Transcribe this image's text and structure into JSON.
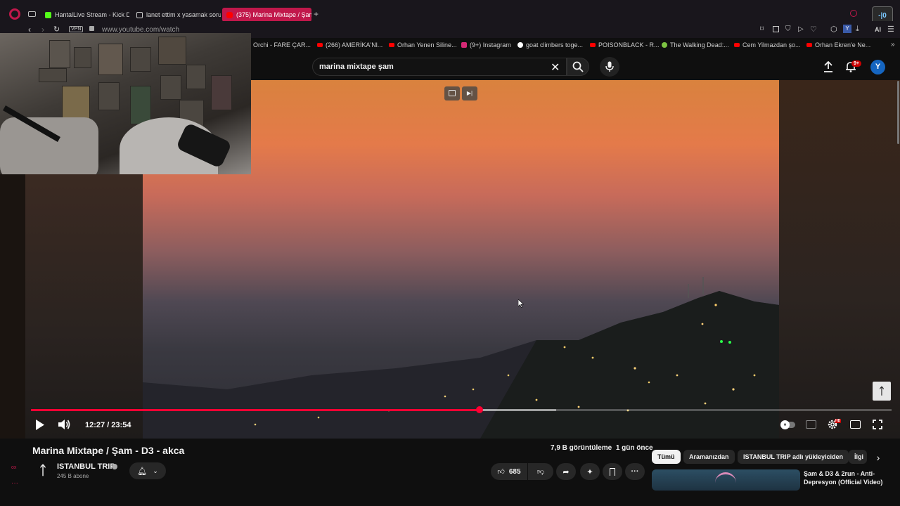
{
  "browser": {
    "tabs": [
      {
        "label": "HantalLive Stream - Kick D...",
        "color": "#53fc18"
      },
      {
        "label": "lanet ettim x yasamak soru...",
        "color": "#cccccc"
      },
      {
        "label": "(375) Marina Mixtape / Şam",
        "color": "#ff0000"
      }
    ],
    "vpn": "VPN",
    "url": "www.youtube.com/watch",
    "ai_label": "AI"
  },
  "bookmarks": [
    {
      "label": "Orchi - FARE ÇAR...",
      "color": "#ff0000"
    },
    {
      "label": "(266) AMERİKA'Nl...",
      "color": "#ff0000"
    },
    {
      "label": "Orhan Yenen Siline...",
      "color": "#ff0000"
    },
    {
      "label": "(9+) Instagram",
      "color": "#d62976"
    },
    {
      "label": "goat climbers toge...",
      "color": "#ffffff"
    },
    {
      "label": "POISONBLACK - R...",
      "color": "#ff0000"
    },
    {
      "label": "The Walking Dead:...",
      "color": "#7cc242"
    },
    {
      "label": "Cem Yilmazdan şo...",
      "color": "#ff0000"
    },
    {
      "label": "Orhan Ekren'e Ne...",
      "color": "#ff0000"
    }
  ],
  "youtube": {
    "search_query": "marina mixtape şam",
    "notif_count": "9+",
    "avatar_letter": "Y"
  },
  "player": {
    "current_time": "12:27",
    "duration": "23:54",
    "time_display": "12:27 / 23:54",
    "progress_fraction": 0.521,
    "buffered_fraction": 0.61,
    "hd_badge": "HD"
  },
  "video": {
    "title": "Marina Mixtape / Şam - D3 - akca",
    "views": "7,9 B görüntüleme",
    "age": "1 gün önce",
    "channel": "ISTANBUL TRIP",
    "subscribers": "245 B abone",
    "likes": "685"
  },
  "chips": [
    {
      "label": "Tümü",
      "selected": true
    },
    {
      "label": "Aramanızdan",
      "selected": false
    },
    {
      "label": "ISTANBUL TRIP adlı yükleyiciden",
      "selected": false
    },
    {
      "label": "İlgi",
      "selected": false
    }
  ],
  "recommendation": {
    "title": "Şam & D3 & 2run - Anti-Depresyon (Official Video)"
  },
  "sidebar": {
    "label_bottom": "ox"
  }
}
